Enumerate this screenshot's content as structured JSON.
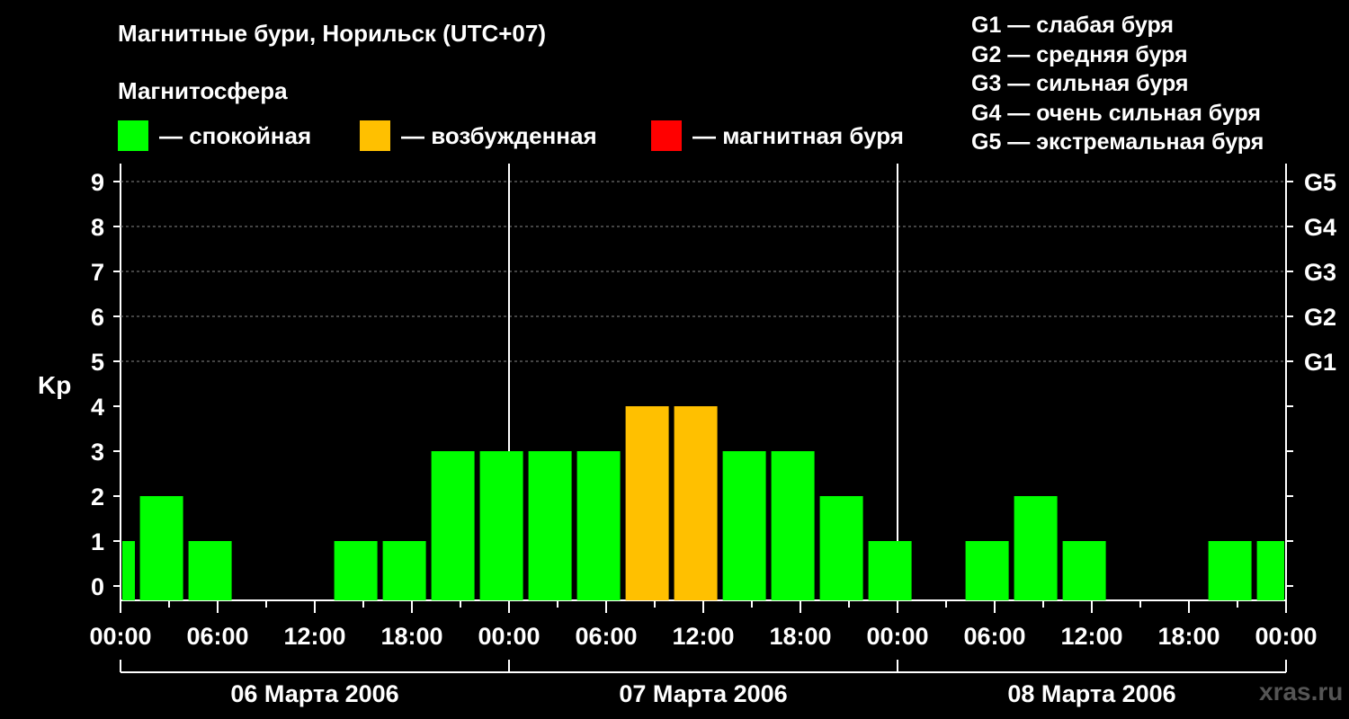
{
  "title": "Магнитные бури, Норильск (UTC+07)",
  "subtitle": "Магнитосфера",
  "legend": [
    {
      "label": "— спокойная",
      "color": "#00ff00"
    },
    {
      "label": "— возбужденная",
      "color": "#ffc000"
    },
    {
      "label": "— магнитная буря",
      "color": "#ff0000"
    }
  ],
  "storm_scale": [
    "G1 — слабая буря",
    "G2 — средняя буря",
    "G3 — сильная буря",
    "G4 — очень сильная буря",
    "G5 — экстремальная буря"
  ],
  "watermark": "xras.ru",
  "chart_data": {
    "type": "bar",
    "ylabel": "Kp",
    "ylim": [
      0,
      9
    ],
    "yticks": [
      "0",
      "1",
      "2",
      "3",
      "4",
      "5",
      "6",
      "7",
      "8",
      "9"
    ],
    "right_ticks": [
      {
        "value": 5,
        "label": "G1"
      },
      {
        "value": 6,
        "label": "G2"
      },
      {
        "value": 7,
        "label": "G3"
      },
      {
        "value": 8,
        "label": "G4"
      },
      {
        "value": 9,
        "label": "G5"
      }
    ],
    "xtick_labels": [
      "00:00",
      "06:00",
      "12:00",
      "18:00",
      "00:00",
      "06:00",
      "12:00",
      "18:00",
      "00:00",
      "06:00",
      "12:00",
      "18:00",
      "00:00"
    ],
    "days": [
      "06 Марта 2006",
      "07 Марта 2006",
      "08 Марта 2006"
    ],
    "grid": "dashed at 5-9",
    "colors": {
      "quiet": "#00ff00",
      "disturbed": "#ffc000",
      "storm": "#ff0000"
    },
    "values": [
      1,
      2,
      1,
      0,
      0,
      1,
      1,
      3,
      3,
      3,
      3,
      4,
      4,
      3,
      3,
      2,
      1,
      0,
      1,
      2,
      1,
      0,
      0,
      1,
      1
    ]
  }
}
